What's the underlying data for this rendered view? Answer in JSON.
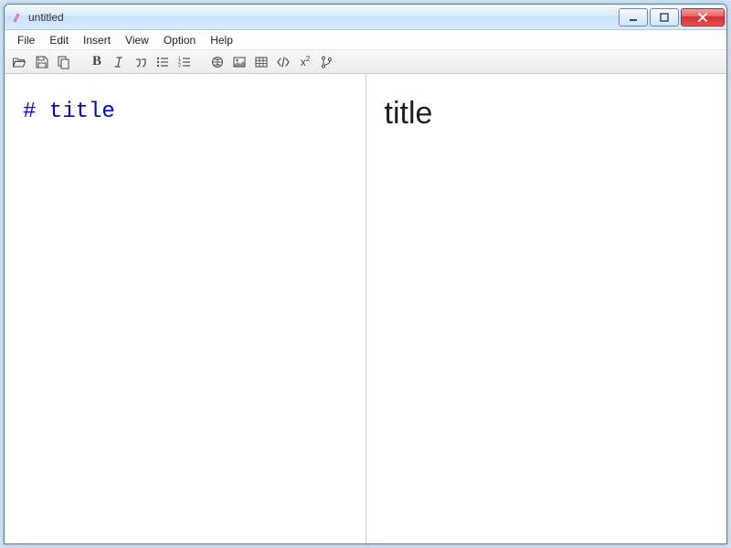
{
  "window": {
    "title": "untitled"
  },
  "menu": {
    "file": "File",
    "edit": "Edit",
    "insert": "Insert",
    "view": "View",
    "option": "Option",
    "help": "Help"
  },
  "toolbar": {
    "open": "open",
    "save": "save",
    "copy": "copy",
    "bold": "B",
    "italic": "italic",
    "quote": "quote",
    "ul": "ul",
    "ol": "ol",
    "globe": "globe",
    "image": "image",
    "table": "table",
    "code": "code",
    "superscript": "x",
    "superscript_exp": "2",
    "branch": "branch"
  },
  "editor": {
    "source": "# title"
  },
  "preview": {
    "heading": "title"
  }
}
